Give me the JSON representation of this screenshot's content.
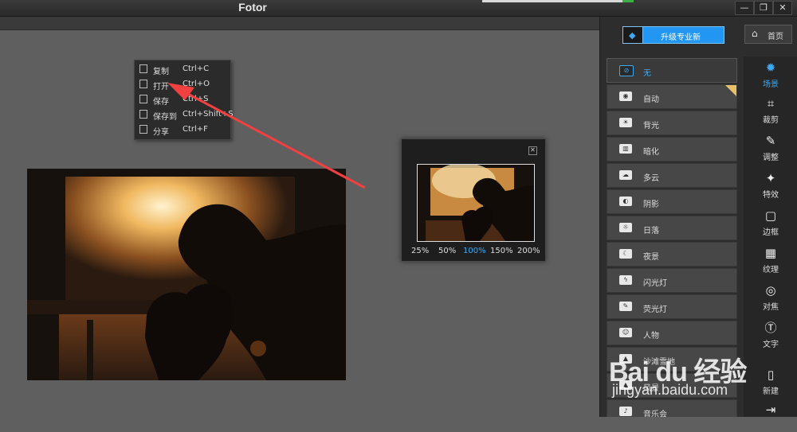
{
  "window": {
    "title": "Fotor",
    "minimize_glyph": "—",
    "restore_glyph": "❐",
    "close_glyph": "✕"
  },
  "context_menu": {
    "items": [
      {
        "label": "复制",
        "shortcut": "Ctrl+C",
        "icon": "copy-icon"
      },
      {
        "label": "打开",
        "shortcut": "Ctrl+O",
        "icon": "open-file-icon"
      },
      {
        "label": "保存",
        "shortcut": "Ctrl+S",
        "icon": "save-icon"
      },
      {
        "label": "保存到",
        "shortcut": "Ctrl+Shift+S",
        "icon": "save-to-icon"
      },
      {
        "label": "分享",
        "shortcut": "Ctrl+F",
        "icon": "share-icon"
      }
    ]
  },
  "zoom_preview": {
    "close_glyph": "✕",
    "levels": [
      "25%",
      "50%",
      "100%",
      "150%",
      "200%"
    ],
    "active_level": "100%"
  },
  "right_panel": {
    "upgrade_label": "升级专业新",
    "home_label": "首页",
    "scenes": [
      {
        "label": "无",
        "icon": "none-icon",
        "selected": true
      },
      {
        "label": "自动",
        "icon": "camera-icon",
        "pro": true
      },
      {
        "label": "背光",
        "icon": "backlight-icon"
      },
      {
        "label": "暗化",
        "icon": "darken-icon"
      },
      {
        "label": "多云",
        "icon": "cloud-icon"
      },
      {
        "label": "阴影",
        "icon": "shadow-icon"
      },
      {
        "label": "日落",
        "icon": "sunset-icon"
      },
      {
        "label": "夜景",
        "icon": "night-icon"
      },
      {
        "label": "闪光灯",
        "icon": "flash-icon"
      },
      {
        "label": "荧光灯",
        "icon": "fluorescent-icon"
      },
      {
        "label": "人物",
        "icon": "portrait-icon"
      },
      {
        "label": "沙滩雪地",
        "icon": "beach-icon"
      },
      {
        "label": "风景",
        "icon": "landscape-icon"
      },
      {
        "label": "音乐会",
        "icon": "concert-icon"
      }
    ],
    "tools": [
      {
        "label": "场景",
        "icon": "sun-icon",
        "active": true
      },
      {
        "label": "裁剪",
        "icon": "crop-icon"
      },
      {
        "label": "调整",
        "icon": "pencil-icon"
      },
      {
        "label": "特效",
        "icon": "sparkle-icon"
      },
      {
        "label": "边框",
        "icon": "frame-icon"
      },
      {
        "label": "纹理",
        "icon": "texture-icon"
      },
      {
        "label": "对焦",
        "icon": "focus-icon"
      },
      {
        "label": "文字",
        "icon": "text-icon"
      },
      {
        "label": "新建",
        "icon": "new-file-icon"
      },
      {
        "label": "",
        "icon": "import-icon"
      }
    ]
  },
  "watermark": {
    "brand": "Bai du 经验",
    "url": "jingyan.baidu.com"
  },
  "colors": {
    "accent": "#2196f3",
    "arrow": "#f04040",
    "canvas_bg": "#5f5f5f",
    "panel_bg": "#2d2d2d"
  }
}
